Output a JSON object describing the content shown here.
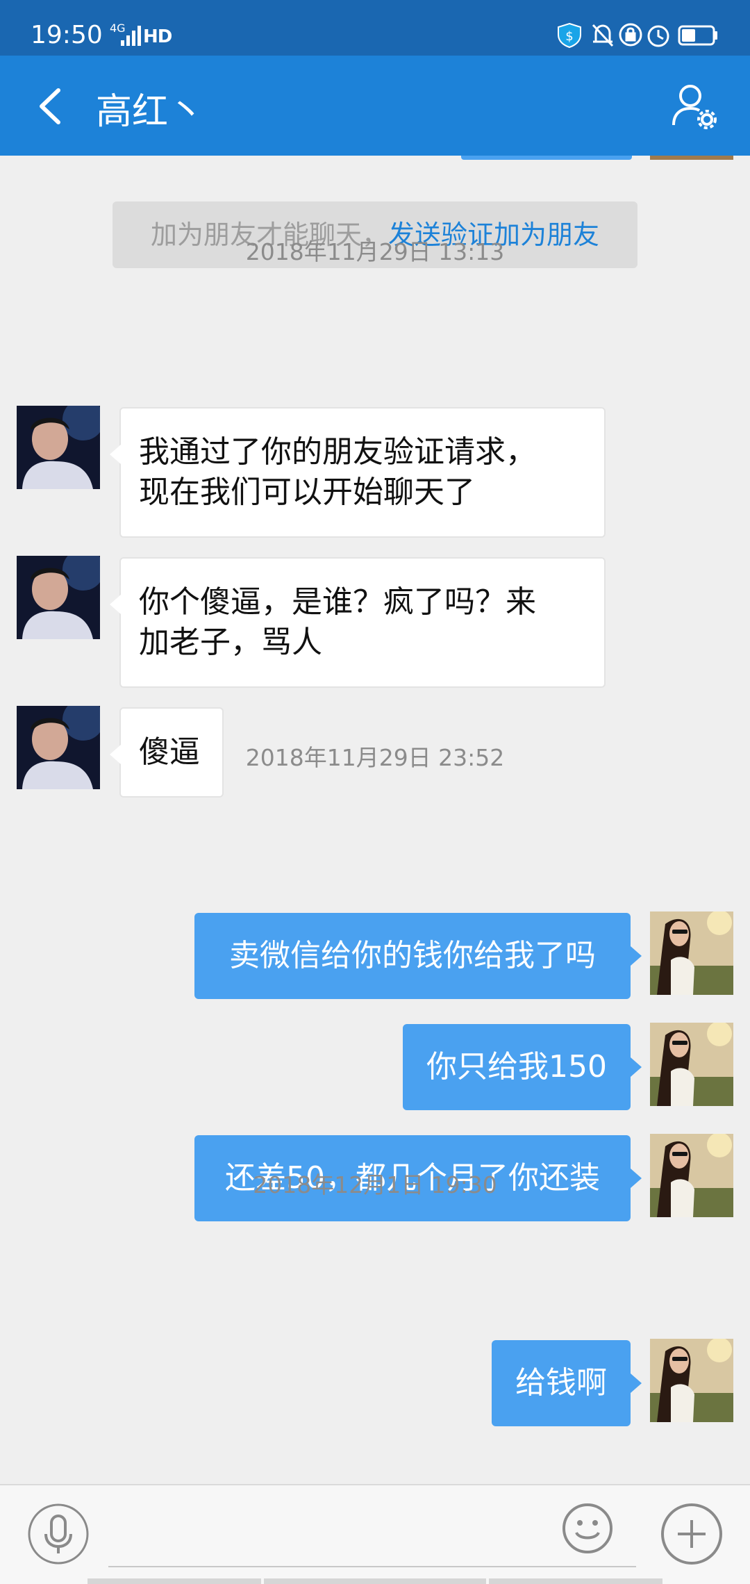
{
  "status_bar": {
    "time": "19:50",
    "network": "4G",
    "hd": "HD",
    "battery_level": 0.45
  },
  "header": {
    "title": "高红丶"
  },
  "system_note": {
    "text": "加为朋友才能聊天，",
    "link": "发送验证加为朋友"
  },
  "messages": [
    {
      "type": "timestamp",
      "text": "2018年11月29日 13:13"
    },
    {
      "type": "incoming",
      "lines": [
        "我通过了你的朋友验证请求，",
        "现在我们可以开始聊天了"
      ]
    },
    {
      "type": "incoming",
      "lines": [
        "你个傻逼，是谁？疯了吗？来",
        "加老子，骂人"
      ]
    },
    {
      "type": "incoming",
      "lines": [
        "傻逼"
      ]
    },
    {
      "type": "timestamp",
      "text": "2018年11月29日 23:52"
    },
    {
      "type": "outgoing",
      "text": "卖微信给你的钱你给我了吗"
    },
    {
      "type": "outgoing",
      "text": "你只给我150"
    },
    {
      "type": "outgoing",
      "text": "还差50，都几个月了你还装"
    },
    {
      "type": "timestamp",
      "text": "2018年12月1日 19:30"
    },
    {
      "type": "outgoing",
      "text": "给钱啊"
    }
  ],
  "icons": {
    "back": "chevron-left-icon",
    "profile": "user-settings-icon",
    "voice": "microphone-icon",
    "emoji": "smiley-icon",
    "more": "plus-icon"
  },
  "colors": {
    "status_bar": "#1a67b1",
    "title_bar": "#1d82d8",
    "outgoing_bubble": "#4aa1f0",
    "incoming_bubble": "#ffffff",
    "chat_background": "#efefef",
    "link": "#1d82d8"
  }
}
